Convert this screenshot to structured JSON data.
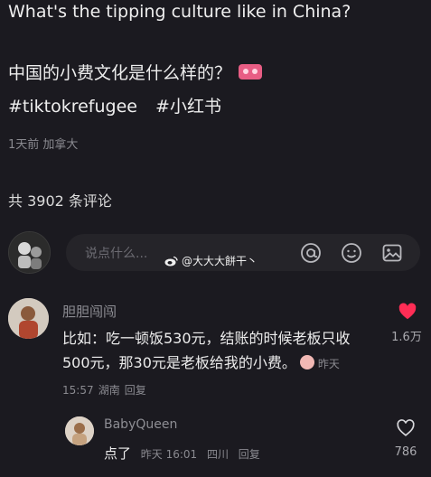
{
  "post": {
    "title": "What's the tipping culture like in China?",
    "body": "中国的小费文化是什么样的？",
    "tags": [
      "#tiktokrefugee",
      "#小红书"
    ],
    "meta": "1天前 加拿大",
    "comment_count": "共 3902 条评论"
  },
  "composer": {
    "placeholder": "说点什么...",
    "watermark": "@大大大餅干丶"
  },
  "comments": [
    {
      "author": "胆胆闯闯",
      "text": "比如：吃一顿饭530元，结账的时候老板只收500元，那30元是老板给我的小费。",
      "time": "昨天 15:57",
      "location": "湖南",
      "reply_label": "回复",
      "likes": "1.6万",
      "liked": true
    },
    {
      "author": "BabyQueen",
      "text": "点了",
      "time": "昨天 16:01",
      "location": "四川",
      "reply_label": "回复",
      "likes": "786",
      "liked": false
    }
  ],
  "colors": {
    "background": "#1b1a20",
    "liked_heart": "#ff2d55",
    "muted_text": "#8a8a90"
  }
}
